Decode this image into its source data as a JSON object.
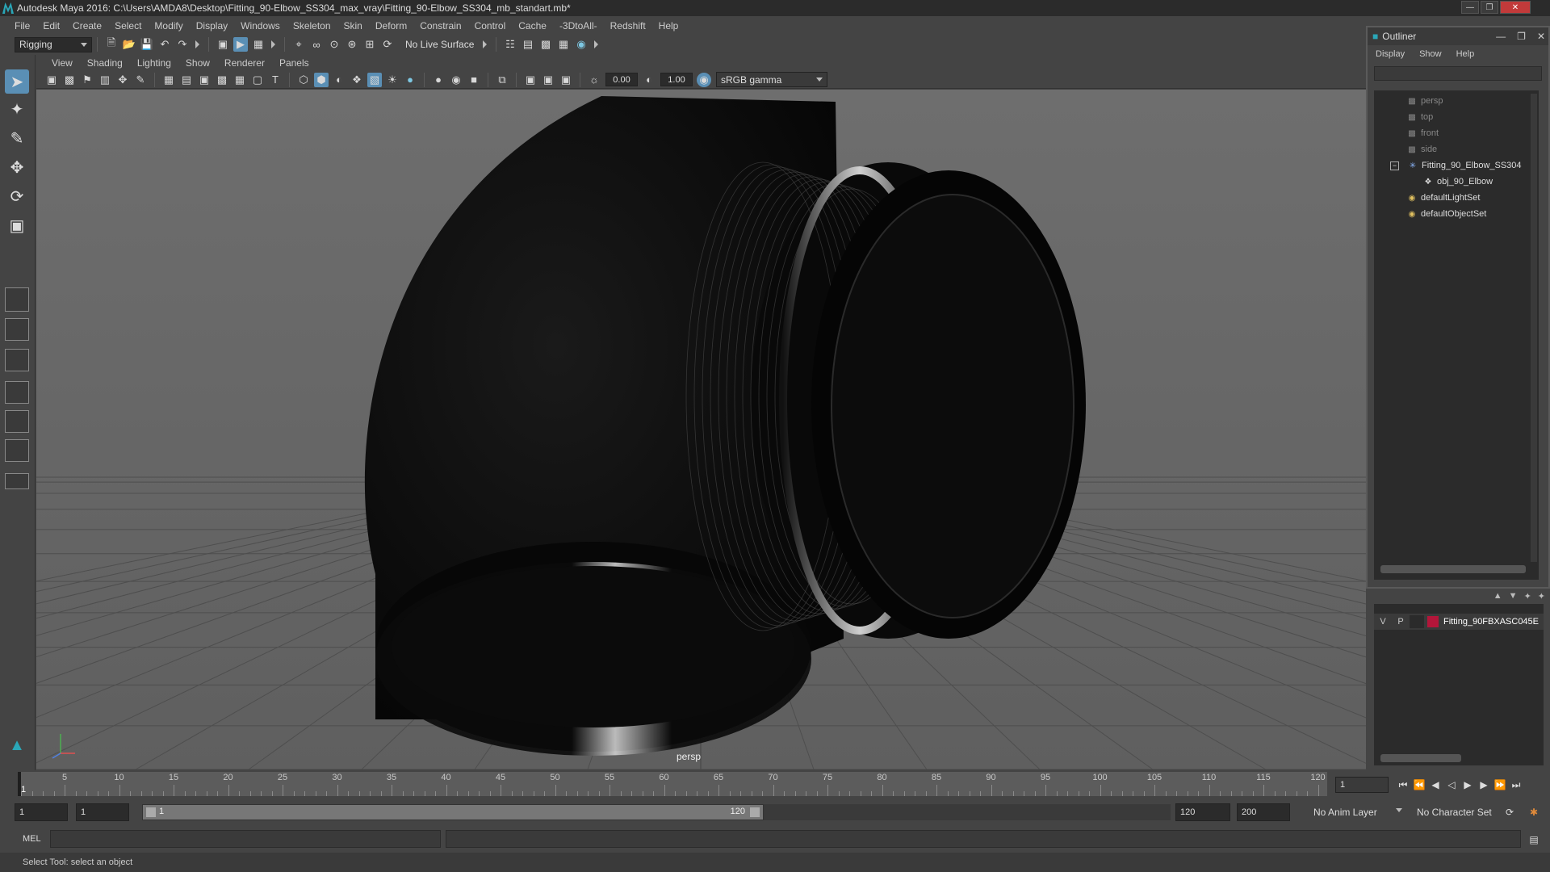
{
  "window": {
    "title": "Autodesk Maya 2016: C:\\Users\\AMDA8\\Desktop\\Fitting_90-Elbow_SS304_max_vray\\Fitting_90-Elbow_SS304_mb_standart.mb*"
  },
  "menubar": {
    "items": [
      "File",
      "Edit",
      "Create",
      "Select",
      "Modify",
      "Display",
      "Windows",
      "Skeleton",
      "Skin",
      "Deform",
      "Constrain",
      "Control",
      "Cache",
      "-3DtoAll-",
      "Redshift",
      "Help"
    ]
  },
  "statusline": {
    "menuset": "Rigging",
    "live_surface": "No Live Surface"
  },
  "viewport": {
    "menus": [
      "View",
      "Shading",
      "Lighting",
      "Show",
      "Renderer",
      "Panels"
    ],
    "exposure": "0.00",
    "gamma": "1.00",
    "color_space": "sRGB gamma",
    "camera": "persp"
  },
  "outliner": {
    "title": "Outliner",
    "menus": [
      "Display",
      "Show",
      "Help"
    ],
    "items": [
      {
        "label": "persp",
        "icon": "camera-icon"
      },
      {
        "label": "top",
        "icon": "camera-icon"
      },
      {
        "label": "front",
        "icon": "camera-icon"
      },
      {
        "label": "side",
        "icon": "camera-icon"
      },
      {
        "label": "Fitting_90_Elbow_SS304",
        "icon": "group-icon"
      },
      {
        "label": "obj_90_Elbow",
        "icon": "mesh-icon"
      },
      {
        "label": "defaultLightSet",
        "icon": "set-icon"
      },
      {
        "label": "defaultObjectSet",
        "icon": "set-icon"
      }
    ]
  },
  "layers": {
    "visible": "V",
    "playback": "P",
    "name": "Fitting_90FBXASC045E",
    "color": "#b3163a"
  },
  "timeline": {
    "ticks": [
      "5",
      "10",
      "15",
      "20",
      "25",
      "30",
      "35",
      "40",
      "45",
      "50",
      "55",
      "60",
      "65",
      "70",
      "75",
      "80",
      "85",
      "90",
      "95",
      "100",
      "105",
      "110",
      "115",
      "120"
    ],
    "current_frame_label": "1",
    "current_frame": "1"
  },
  "range": {
    "start": "1",
    "playback_start": "1",
    "slider_start": "1",
    "slider_end": "120",
    "playback_end": "120",
    "end": "200",
    "anim_layer": "No Anim Layer",
    "character_set": "No Character Set"
  },
  "command": {
    "language": "MEL"
  },
  "help": {
    "text": "Select Tool: select an object"
  },
  "colors": {
    "accent": "#5a8fb5",
    "panel": "#444444",
    "field": "#2b2b2b"
  }
}
